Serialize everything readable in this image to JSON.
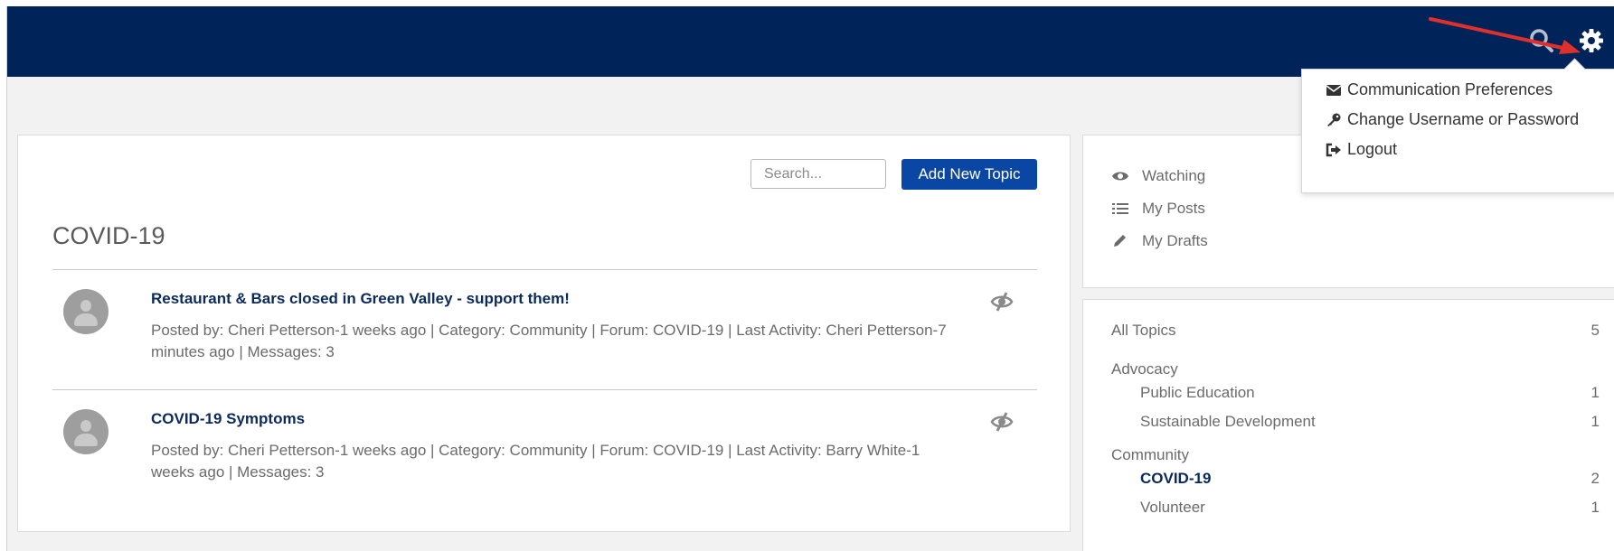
{
  "header": {
    "search_icon": "search-icon",
    "settings_icon": "gear-icon",
    "bar_color": "#00245a"
  },
  "settings_menu": {
    "items": [
      {
        "label": "Communication Preferences",
        "icon": "envelope-icon"
      },
      {
        "label": "Change Username or Password",
        "icon": "key-icon"
      },
      {
        "label": "Logout",
        "icon": "sign-out-icon"
      }
    ]
  },
  "main": {
    "search_placeholder": "Search...",
    "add_button_label": "Add New Topic",
    "title": "COVID-19",
    "topics": [
      {
        "title": "Restaurant & Bars closed in Green Valley - support them!",
        "meta": "Posted by: Cheri Petterson-1 weeks ago | Category: Community | Forum: COVID-19 | Last Activity: Cheri Petterson-7 minutes ago | Messages: 3"
      },
      {
        "title": "COVID-19 Symptoms",
        "meta": "Posted by: Cheri Petterson-1 weeks ago | Category: Community | Forum: COVID-19 | Last Activity: Barry White-1 weeks ago | Messages: 3"
      }
    ]
  },
  "sidebar": {
    "links": [
      {
        "label": "Watching",
        "icon": "eye-icon"
      },
      {
        "label": "My Posts",
        "icon": "list-icon"
      },
      {
        "label": "My Drafts",
        "icon": "pencil-icon"
      }
    ],
    "all_topics": {
      "label": "All Topics",
      "count": "5"
    },
    "categories": [
      {
        "name": "Advocacy",
        "forums": [
          {
            "label": "Public Education",
            "count": "1"
          },
          {
            "label": "Sustainable Development",
            "count": "1"
          }
        ]
      },
      {
        "name": "Community",
        "forums": [
          {
            "label": "COVID-19",
            "count": "2",
            "active": true
          },
          {
            "label": "Volunteer",
            "count": "1"
          }
        ]
      }
    ]
  },
  "colors": {
    "accent": "#0a46a3",
    "link": "#0b2a5b",
    "annotation_arrow": "#e0302b"
  }
}
